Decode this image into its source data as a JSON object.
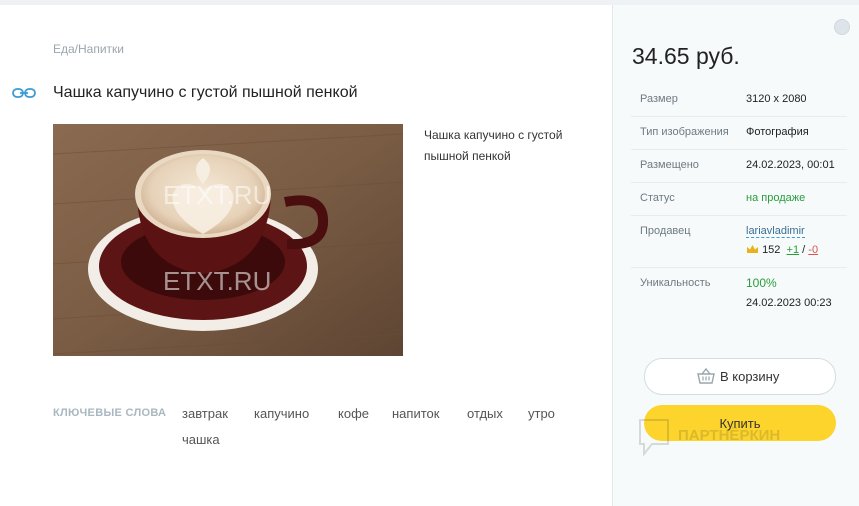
{
  "breadcrumb": "Еда/Напитки",
  "title": "Чашка капучино с густой пышной пенкой",
  "description": "Чашка капучино с густой пышной пенкой",
  "photo": {
    "watermark_top": "ETXT.RU",
    "watermark_bottom": "ETXT.RU"
  },
  "keywords": {
    "label": "КЛЮЧЕВЫЕ СЛОВА",
    "items": [
      "завтрак",
      "капучино",
      "кофе",
      "напиток",
      "отдых",
      "утро",
      "чашка"
    ]
  },
  "price": "34.65 руб.",
  "props": {
    "size_label": "Размер",
    "size_value": "3120 x 2080",
    "type_label": "Тип изображения",
    "type_value": "Фотография",
    "posted_label": "Размещено",
    "posted_value": "24.02.2023, 00:01",
    "status_label": "Статус",
    "status_value": "на продаже",
    "seller_label": "Продавец",
    "seller_name": "lariavladimir",
    "seller_rating": "152",
    "seller_plus": "+1",
    "seller_sep": "/",
    "seller_minus": "-0",
    "uniq_label": "Уникальность",
    "uniq_value": "100%",
    "uniq_date": "24.02.2023 00:23"
  },
  "buttons": {
    "cart": "В корзину",
    "buy": "Купить"
  },
  "side_watermark": "ПАРТНЁРКИН",
  "colors": {
    "accent_yellow": "#fcd42c",
    "status_green": "#2a9d3a",
    "link_blue": "#3a9bd5",
    "crown_gold": "#e8b21c"
  }
}
